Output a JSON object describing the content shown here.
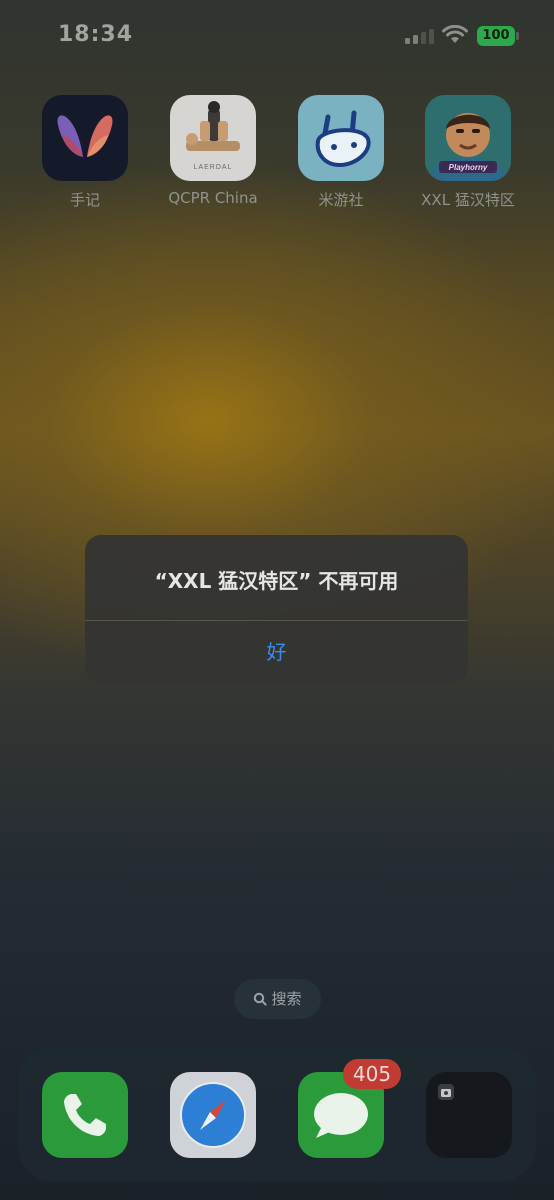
{
  "status_bar": {
    "time": "18:34",
    "battery_level": "100",
    "battery_color": "#2ca94a",
    "signal_icon": "cellular-signal-icon",
    "wifi_icon": "wifi-icon"
  },
  "apps": [
    {
      "label": "手记",
      "icon": "journal-app-icon"
    },
    {
      "label": "QCPR China",
      "icon": "qcpr-app-icon",
      "icon_text": "LAERDAL"
    },
    {
      "label": "米游社",
      "icon": "miyoushe-app-icon"
    },
    {
      "label": "XXL 猛汉特区",
      "icon": "xxl-app-icon",
      "icon_text": "Playhorny"
    }
  ],
  "dialog": {
    "title": "“XXL 猛汉特区” 不再可用",
    "ok_label": "好",
    "accent_color": "#3b8cf0"
  },
  "search": {
    "label": "搜索",
    "icon": "search-icon"
  },
  "dock": {
    "apps": [
      {
        "name": "phone",
        "icon": "phone-icon"
      },
      {
        "name": "safari",
        "icon": "safari-compass-icon"
      },
      {
        "name": "messages",
        "icon": "messages-bubble-icon",
        "badge": "405"
      },
      {
        "name": "camera-folder",
        "icon": "camera-icon"
      }
    ],
    "badge_color": "#c23b33"
  }
}
